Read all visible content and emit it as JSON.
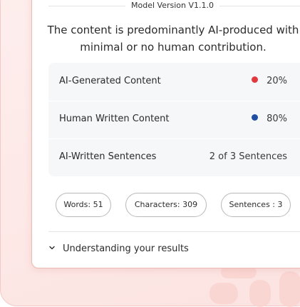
{
  "model_version": "Model Version V1.1.0",
  "verdict": {
    "line1": "The content is predominantly AI-produced with",
    "line2": "minimal or no human contribution."
  },
  "stats": [
    {
      "label": "AI-Generated Content",
      "value": "20%",
      "dot_color": "#e0393e"
    },
    {
      "label": "Human Written Content",
      "value": "80%",
      "dot_color": "#1f4ea3"
    },
    {
      "label": "AI-Written Sentences",
      "value": "2 of 3 Sentences"
    }
  ],
  "counts": {
    "words": "Words: 51",
    "characters": "Characters: 309",
    "sentences": "Sentences : 3"
  },
  "understanding": {
    "label": "Understanding your results",
    "icon": "chevron-down-icon"
  },
  "colors": {
    "accent_pink": "#efb9b4",
    "background_pink": "#fdeeed",
    "ai_red": "#e0393e",
    "human_blue": "#1f4ea3"
  }
}
